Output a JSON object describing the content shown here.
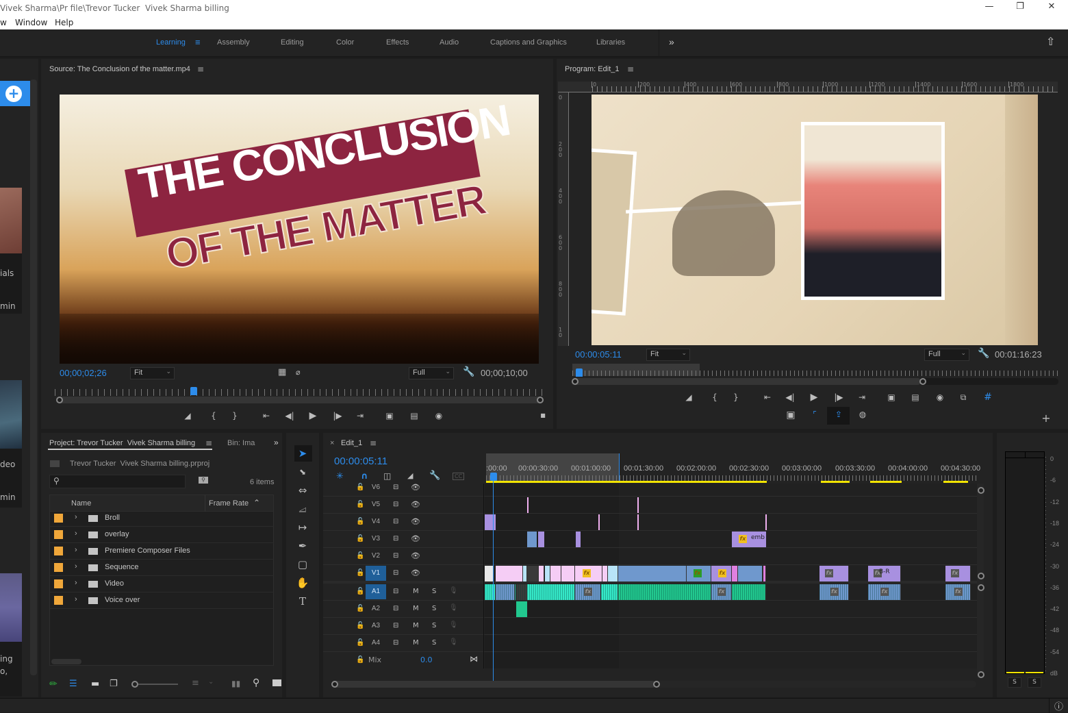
{
  "window": {
    "title": "Vivek Sharma\\Pr file\\Trevor Tucker  Vivek Sharma billing",
    "controls": [
      "minimize",
      "restore",
      "close"
    ]
  },
  "menu": [
    "w",
    "Window",
    "Help"
  ],
  "workspaces": {
    "items": [
      "Learning",
      "Assembly",
      "Editing",
      "Color",
      "Effects",
      "Audio",
      "Captions and Graphics",
      "Libraries"
    ],
    "active": "Learning",
    "overflow": "»"
  },
  "left_learn_panel": {
    "fragments": [
      "ials",
      "min",
      "deo",
      "min",
      "ing",
      "o,"
    ]
  },
  "source_monitor": {
    "title": "Source: The Conclusion of the matter.mp4",
    "frame_text_line1": "THE CONCLUSION",
    "frame_text_line2": "OF THE MATTER",
    "timecode": "00;00;02;26",
    "zoom": "Fit",
    "resolution": "Full",
    "duration": "00;00;10;00",
    "playhead_fraction": 0.28
  },
  "program_monitor": {
    "title": "Program: Edit_1",
    "timecode": "00:00:05:11",
    "zoom": "Fit",
    "resolution": "Full",
    "duration": "00:01:16:23",
    "ruler_h": [
      "0",
      "200",
      "400",
      "600",
      "800",
      "1000",
      "1200",
      "1400",
      "1600",
      "1800"
    ],
    "ruler_v": [
      "0",
      "200",
      "400",
      "600",
      "800",
      "10"
    ],
    "playhead_fraction": 0.01
  },
  "project_panel": {
    "title": "Project: Trevor Tucker  Vivek Sharma billing",
    "bin_tab": "Bin: Ima",
    "project_file": "Trevor Tucker  Vivek Sharma billing.prproj",
    "search_placeholder": "",
    "item_count": "6 items",
    "columns": [
      "Name",
      "Frame Rate"
    ],
    "items": [
      {
        "name": "Broll",
        "color": "#f0a73a"
      },
      {
        "name": "overlay",
        "color": "#f0a73a"
      },
      {
        "name": "Premiere Composer Files",
        "color": "#f0a73a"
      },
      {
        "name": "Sequence",
        "color": "#f0a73a"
      },
      {
        "name": "Video",
        "color": "#f0a73a"
      },
      {
        "name": "Voice over",
        "color": "#f0a73a"
      }
    ]
  },
  "timeline": {
    "tab": "Edit_1",
    "timecode": "00:00:05:11",
    "ruler": [
      ":00:00",
      "00:00:30:00",
      "00:01:00:00",
      "00:01:30:00",
      "00:02:00:00",
      "00:02:30:00",
      "00:03:00:00",
      "00:03:30:00",
      "00:04:00:00",
      "00:04:30:00"
    ],
    "video_tracks": [
      "V6",
      "V5",
      "V4",
      "V3",
      "V2",
      "V1"
    ],
    "audio_tracks": [
      "A1",
      "A2",
      "A3",
      "A4"
    ],
    "selected_tracks": [
      "V1",
      "A1"
    ],
    "audio_buttons": [
      "M",
      "S"
    ],
    "mix_label": "Mix",
    "mix_value": "0.0",
    "clip_labels": {
      "v3_emb": "emb",
      "v1_br": "B-R"
    }
  },
  "audio_meter": {
    "scale": [
      "0",
      "-6",
      "-12",
      "-18",
      "-24",
      "-30",
      "-36",
      "-42",
      "-48",
      "-54",
      "dB"
    ],
    "solo_buttons": [
      "S",
      "S"
    ]
  },
  "colors": {
    "accent": "#2d8ceb",
    "clip_pink": "#f5cdf5",
    "clip_blue": "#6f98cd",
    "clip_purple": "#a890e0",
    "audio_teal": "#35e8c8",
    "audio_green": "#22c88f",
    "folder_label": "#f0a73a"
  }
}
